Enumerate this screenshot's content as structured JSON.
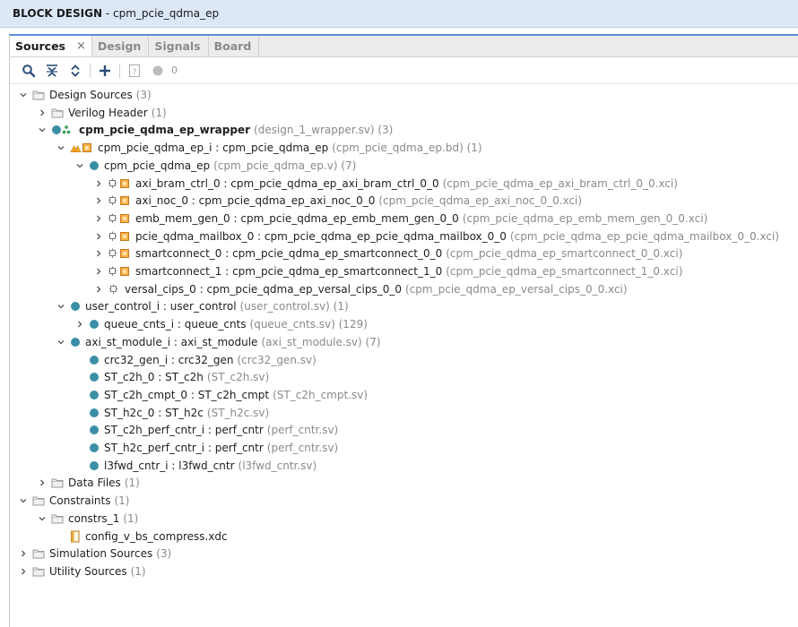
{
  "window": {
    "title_prefix": "BLOCK DESIGN",
    "title_name": " - cpm_pcie_qdma_ep"
  },
  "tabs": [
    {
      "label": "Sources",
      "active": true
    },
    {
      "label": "Design"
    },
    {
      "label": "Signals"
    },
    {
      "label": "Board"
    }
  ],
  "toolbar": {
    "buttons": [
      "search-icon",
      "collapse-all-icon",
      "expand-all-icon",
      "add-sources-icon",
      "hierarchy-help-icon",
      "status-dot-icon"
    ],
    "count": "0"
  },
  "tree": [
    {
      "depth": 0,
      "chev": "down",
      "icon": "folder",
      "name": "Design Sources",
      "extra": "(3)"
    },
    {
      "depth": 1,
      "chev": "right",
      "icon": "folder",
      "name": "Verilog Header",
      "extra": "(1)"
    },
    {
      "depth": 1,
      "chev": "down",
      "icon": "top",
      "name": "cpm_pcie_qdma_ep_wrapper",
      "extra": "(design_1_wrapper.sv) (3)",
      "bold": true
    },
    {
      "depth": 2,
      "chev": "down",
      "icon": "bd",
      "name": "cpm_pcie_qdma_ep_i : cpm_pcie_qdma_ep",
      "extra": "(cpm_pcie_qdma_ep.bd) (1)"
    },
    {
      "depth": 3,
      "chev": "down",
      "icon": "dot",
      "name": "cpm_pcie_qdma_ep",
      "extra": "(cpm_pcie_qdma_ep.v) (7)"
    },
    {
      "depth": 4,
      "chev": "right",
      "icon": "ip",
      "name": "axi_bram_ctrl_0 : cpm_pcie_qdma_ep_axi_bram_ctrl_0_0",
      "extra": "(cpm_pcie_qdma_ep_axi_bram_ctrl_0_0.xci)"
    },
    {
      "depth": 4,
      "chev": "right",
      "icon": "ip",
      "name": "axi_noc_0 : cpm_pcie_qdma_ep_axi_noc_0_0",
      "extra": "(cpm_pcie_qdma_ep_axi_noc_0_0.xci)"
    },
    {
      "depth": 4,
      "chev": "right",
      "icon": "ip",
      "name": "emb_mem_gen_0 : cpm_pcie_qdma_ep_emb_mem_gen_0_0",
      "extra": "(cpm_pcie_qdma_ep_emb_mem_gen_0_0.xci)"
    },
    {
      "depth": 4,
      "chev": "right",
      "icon": "ip",
      "name": "pcie_qdma_mailbox_0 : cpm_pcie_qdma_ep_pcie_qdma_mailbox_0_0",
      "extra": "(cpm_pcie_qdma_ep_pcie_qdma_mailbox_0_0.xci)"
    },
    {
      "depth": 4,
      "chev": "right",
      "icon": "ip",
      "name": "smartconnect_0 : cpm_pcie_qdma_ep_smartconnect_0_0",
      "extra": "(cpm_pcie_qdma_ep_smartconnect_0_0.xci)"
    },
    {
      "depth": 4,
      "chev": "right",
      "icon": "ip",
      "name": "smartconnect_1 : cpm_pcie_qdma_ep_smartconnect_1_0",
      "extra": "(cpm_pcie_qdma_ep_smartconnect_1_0.xci)"
    },
    {
      "depth": 4,
      "chev": "right",
      "icon": "ip-plain",
      "name": "versal_cips_0 : cpm_pcie_qdma_ep_versal_cips_0_0",
      "extra": "(cpm_pcie_qdma_ep_versal_cips_0_0.xci)"
    },
    {
      "depth": 2,
      "chev": "down",
      "icon": "dot",
      "name": "user_control_i : user_control",
      "extra": "(user_control.sv) (1)"
    },
    {
      "depth": 3,
      "chev": "right",
      "icon": "dot",
      "name": "queue_cnts_i : queue_cnts",
      "extra": "(queue_cnts.sv) (129)"
    },
    {
      "depth": 2,
      "chev": "down",
      "icon": "dot",
      "name": "axi_st_module_i : axi_st_module",
      "extra": "(axi_st_module.sv) (7)"
    },
    {
      "depth": 3,
      "chev": "",
      "icon": "dot",
      "name": "crc32_gen_i : crc32_gen",
      "extra": "(crc32_gen.sv)"
    },
    {
      "depth": 3,
      "chev": "",
      "icon": "dot",
      "name": "ST_c2h_0 : ST_c2h",
      "extra": "(ST_c2h.sv)"
    },
    {
      "depth": 3,
      "chev": "",
      "icon": "dot",
      "name": "ST_c2h_cmpt_0 : ST_c2h_cmpt",
      "extra": "(ST_c2h_cmpt.sv)"
    },
    {
      "depth": 3,
      "chev": "",
      "icon": "dot",
      "name": "ST_h2c_0 : ST_h2c",
      "extra": "(ST_h2c.sv)"
    },
    {
      "depth": 3,
      "chev": "",
      "icon": "dot",
      "name": "ST_c2h_perf_cntr_i : perf_cntr",
      "extra": "(perf_cntr.sv)"
    },
    {
      "depth": 3,
      "chev": "",
      "icon": "dot",
      "name": "ST_h2c_perf_cntr_i : perf_cntr",
      "extra": "(perf_cntr.sv)"
    },
    {
      "depth": 3,
      "chev": "",
      "icon": "dot",
      "name": "l3fwd_cntr_i : l3fwd_cntr",
      "extra": "(l3fwd_cntr.sv)"
    },
    {
      "depth": 1,
      "chev": "right",
      "icon": "folder",
      "name": "Data Files",
      "extra": "(1)"
    },
    {
      "depth": 0,
      "chev": "down",
      "icon": "folder",
      "name": "Constraints",
      "extra": "(1)"
    },
    {
      "depth": 1,
      "chev": "down",
      "icon": "folder",
      "name": "constrs_1",
      "extra": "(1)"
    },
    {
      "depth": 2,
      "chev": "",
      "icon": "xdc",
      "name": "config_v_bs_compress.xdc",
      "extra": ""
    },
    {
      "depth": 0,
      "chev": "right",
      "icon": "folder",
      "name": "Simulation Sources",
      "extra": "(3)"
    },
    {
      "depth": 0,
      "chev": "right",
      "icon": "folder",
      "name": "Utility Sources",
      "extra": "(1)"
    }
  ]
}
